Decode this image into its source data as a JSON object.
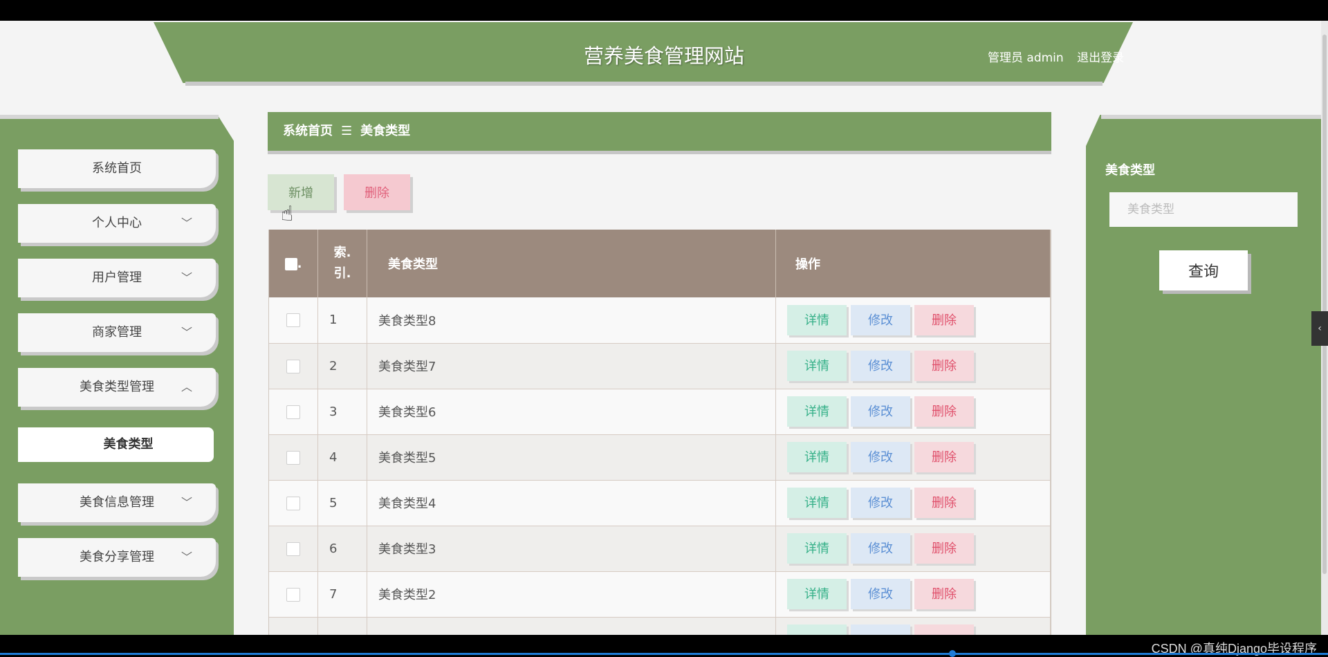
{
  "header": {
    "site_title": "营养美食管理网站",
    "user_label": "管理员 admin",
    "logout_label": "退出登录"
  },
  "sidebar": {
    "items": [
      {
        "label": "系统首页",
        "chevron": ""
      },
      {
        "label": "个人中心",
        "chevron": "﹀"
      },
      {
        "label": "用户管理",
        "chevron": "﹀"
      },
      {
        "label": "商家管理",
        "chevron": "﹀"
      },
      {
        "label": "美食类型管理",
        "chevron": "︿"
      },
      {
        "label": "美食信息管理",
        "chevron": "﹀"
      },
      {
        "label": "美食分享管理",
        "chevron": "﹀"
      }
    ],
    "sub_item": "美食类型"
  },
  "breadcrumb": {
    "home": "系统首页",
    "separator": "☰",
    "current": "美食类型"
  },
  "toolbar": {
    "add_label": "新增",
    "delete_label": "删除"
  },
  "table": {
    "headers": {
      "check_dot": ".",
      "index_line1": "索.",
      "index_line2": "引.",
      "type": "美食类型",
      "ops": "操作"
    },
    "rows": [
      {
        "index": "1",
        "type": "美食类型8"
      },
      {
        "index": "2",
        "type": "美食类型7"
      },
      {
        "index": "3",
        "type": "美食类型6"
      },
      {
        "index": "4",
        "type": "美食类型5"
      },
      {
        "index": "5",
        "type": "美食类型4"
      },
      {
        "index": "6",
        "type": "美食类型3"
      },
      {
        "index": "7",
        "type": "美食类型2"
      },
      {
        "index": "",
        "type": ""
      }
    ],
    "actions": {
      "detail": "详情",
      "edit": "修改",
      "delete": "删除"
    }
  },
  "search": {
    "label": "美食类型",
    "placeholder": "美食类型",
    "button": "查询"
  },
  "icons": {
    "collapse": "chevron-left-icon",
    "cursor": "hand-pointer-icon"
  },
  "colors": {
    "theme_green": "#7a9e62",
    "table_header": "#9c8a7e"
  },
  "collapse_glyph": "‹",
  "watermark": "CSDN @真纯Django毕设程序"
}
